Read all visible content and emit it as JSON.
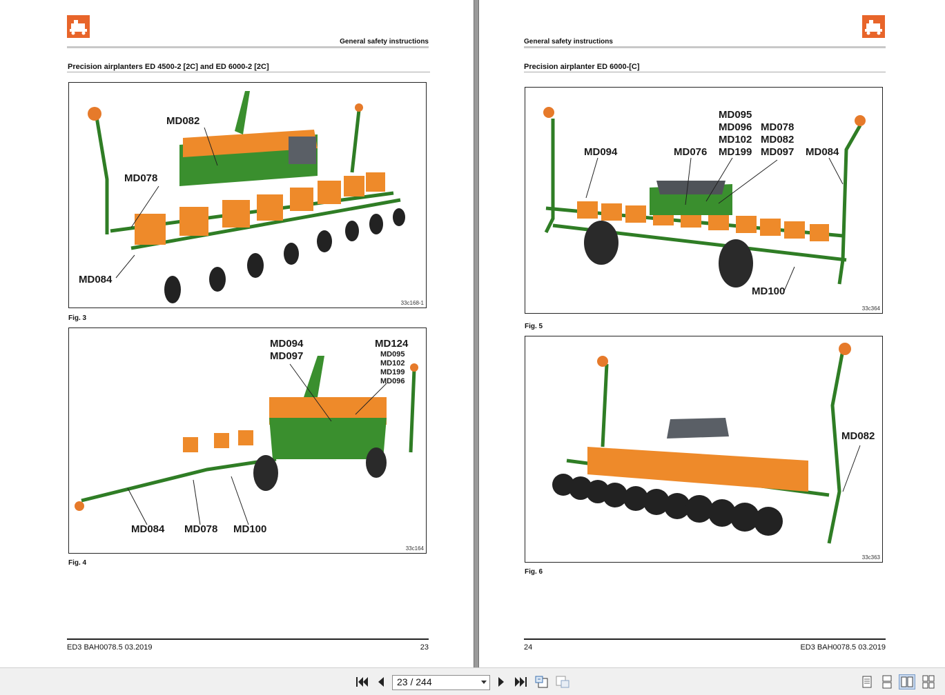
{
  "left_page": {
    "header": "General safety instructions",
    "section_title": "Precision airplanters ED 4500-2 [2C] and ED 6000-2 [2C]",
    "figures": [
      {
        "caption": "Fig. 3",
        "code": "33c168-1",
        "callouts": [
          "MD082",
          "MD078",
          "MD084"
        ]
      },
      {
        "caption": "Fig. 4",
        "code": "33c164",
        "callouts": [
          "MD094",
          "MD097",
          "MD124",
          "MD095",
          "MD102",
          "MD199",
          "MD096",
          "MD084",
          "MD078",
          "MD100"
        ]
      }
    ],
    "footer_doc": "ED3  BAH0078.5  03.2019",
    "footer_page": "23"
  },
  "right_page": {
    "header": "General safety instructions",
    "section_title": "Precision airplanter ED 6000-[C]",
    "figures": [
      {
        "caption": "Fig. 5",
        "code": "33c364",
        "callouts": [
          "MD095",
          "MD096",
          "MD078",
          "MD102",
          "MD082",
          "MD094",
          "MD076",
          "MD199",
          "MD097",
          "MD084",
          "MD100"
        ]
      },
      {
        "caption": "Fig. 6",
        "code": "33c363",
        "callouts": [
          "MD082"
        ]
      }
    ],
    "footer_page": "24",
    "footer_doc": "ED3  BAH0078.5  03.2019"
  },
  "toolbar": {
    "page_indicator": "23 / 244",
    "buttons": [
      "first-page-icon",
      "previous-page-icon",
      "next-page-icon",
      "last-page-icon",
      "go-back-view-icon",
      "go-forward-view-icon",
      "single-page-view-icon",
      "continuous-view-icon",
      "two-page-view-icon",
      "two-page-continuous-view-icon"
    ]
  },
  "colors": {
    "brand": "#e8652a",
    "machine_green": "#3a8f2e",
    "hopper_orange": "#ee8a2a"
  }
}
